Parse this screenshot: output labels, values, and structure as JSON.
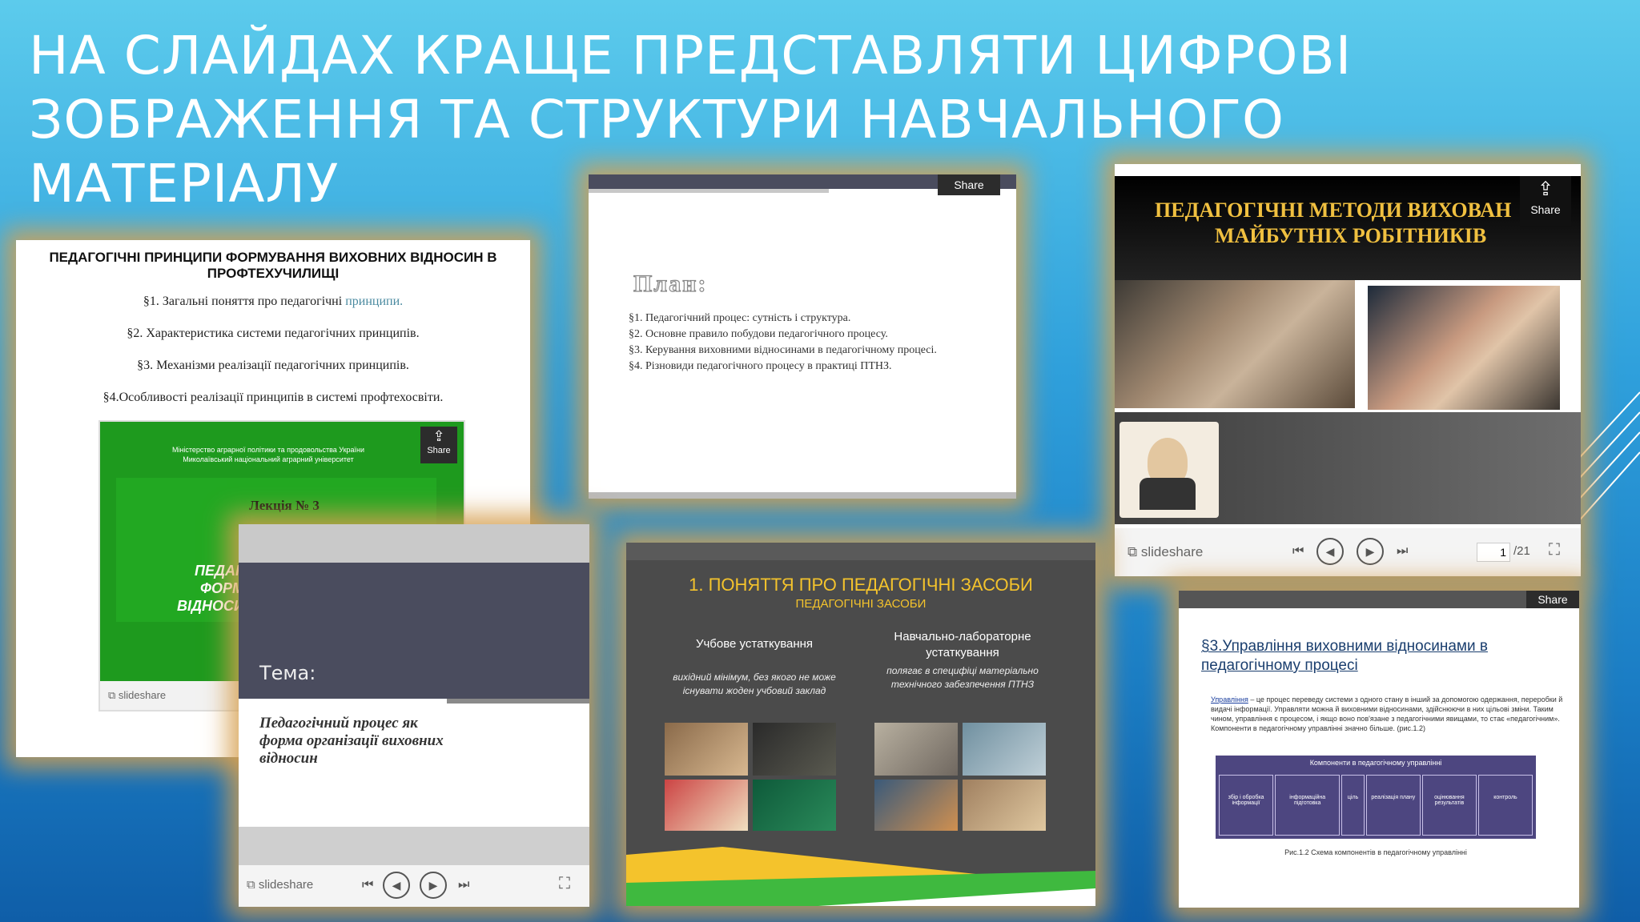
{
  "title": {
    "line1": "На слайдах краще представляти цифрові",
    "line2": "зображення та структури навчального матеріалу"
  },
  "slide1": {
    "heading": "ПЕДАГОГІЧНІ ПРИНЦИПИ ФОРМУВАННЯ ВИХОВНИХ ВІДНОСИН В ПРОФТЕХУЧИЛИЩІ",
    "items": [
      {
        "text": "§1. Загальні поняття про педагогічні ",
        "link": "принципи."
      },
      {
        "text": "§2. Характеристика системи педагогічних принципів.",
        "link": ""
      },
      {
        "text": "§3. Механізми реалізації педагогічних принципів.",
        "link": ""
      },
      {
        "text": "§4.Особливості реалізації принципів в системі профтехосвіти.",
        "link": ""
      }
    ],
    "inner": {
      "ministry": "Міністерство аграрної політики та продовольства України",
      "university": "Миколаївський національний аграрний університет",
      "lecture": "Лекція № 3",
      "partial": [
        "ПЕДАГ",
        "ФОРМ",
        "ВІДНОСИ"
      ],
      "share": "Share",
      "logo": "slideshare"
    }
  },
  "slide2": {
    "share": "Share",
    "plan_title": "План:",
    "items": [
      "§1. Педагогічний процес: сутність і структура.",
      "§2. Основне правило побудови педагогічного процесу.",
      "§3. Керування виховними відносинами в педагогічному процесі.",
      "§4. Різновиди педагогічного процесу в практиці ПТНЗ."
    ]
  },
  "slide3": {
    "title_line1": "ПЕДАГОГІЧНІ МЕТОДИ ВИХОВАН",
    "title_line2": "МАЙБУТНІХ РОБІТНИКІВ",
    "share": "Share",
    "logo": "slideshare",
    "page_current": "1",
    "page_total": "/21"
  },
  "slide4": {
    "label": "Тема:",
    "subtitle": "Педагогічний процес як форма організації виховних відносин",
    "logo": "slideshare"
  },
  "slide5": {
    "title": "1. ПОНЯТТЯ ПРО ПЕДАГОГІЧНІ ЗАСОБИ",
    "subtitle": "ПЕДАГОГІЧНІ ЗАСОБИ",
    "col1_head": "Учбове устаткування",
    "col1_text": "вихідний мінімум, без якого не може існувати жоден учбовий заклад",
    "col2_head": "Навчально-лабораторне устаткування",
    "col2_text": "полягає в специфіці матеріально технічного забезпечення ПТНЗ"
  },
  "slide6": {
    "share": "Share",
    "heading": "§3.Управління виховними відносинами в педагогічному процесі",
    "para_link": "Управління",
    "para": " – це процес переведу системи з одного стану в інший за допомогою одержання, переробки й видачі інформації. Управляти можна й виховними відносинами, здійснюючи в них цільові зміни. Таким чином, управління є процесом, і якщо воно пов'язане з педагогічними явищами, то стає «педагогічним». Компоненти в педагогічному управлінні значно більше. (рис.1.2)",
    "table_head": "Компоненти в педагогічному управлінні",
    "cells": [
      "збір і обробка інформації",
      "інформаційна підготовка",
      "ціль",
      "реалізація плану",
      "оцінювання результатів",
      "контроль"
    ],
    "caption": "Рис.1.2 Схема компонентів в педагогічному управлінні"
  },
  "colors": {
    "accent_green": "#1e9a1e",
    "glow": "#d6a050",
    "dark_slate": "#4a4c5e"
  }
}
